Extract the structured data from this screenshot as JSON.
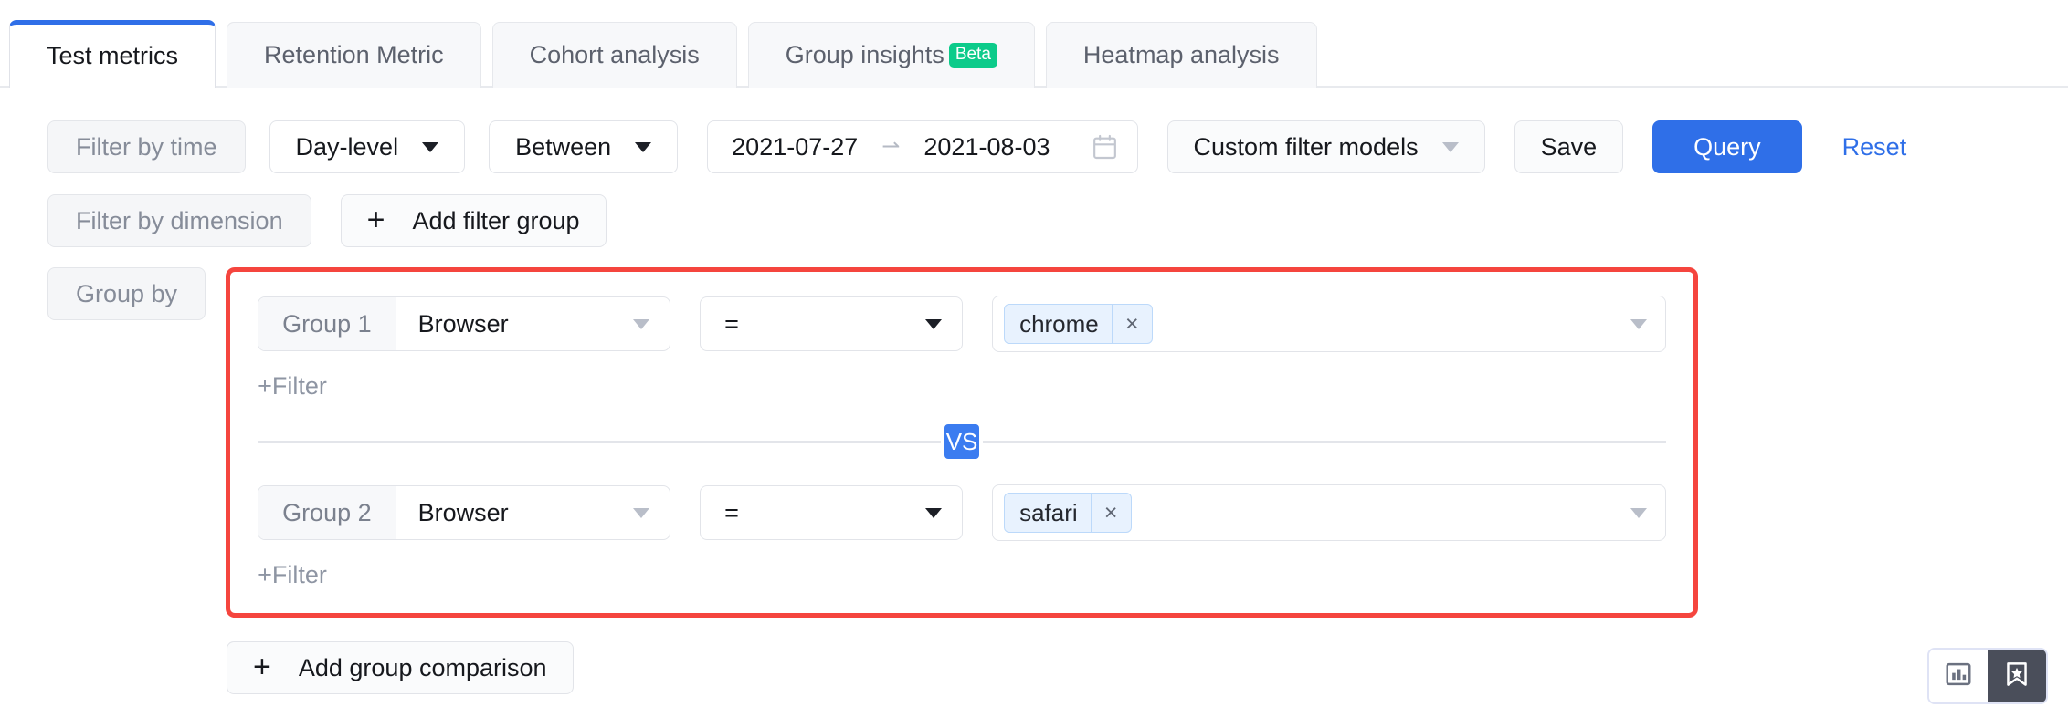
{
  "tabs": [
    {
      "label": "Test metrics",
      "active": true,
      "badge": ""
    },
    {
      "label": "Retention Metric",
      "active": false,
      "badge": ""
    },
    {
      "label": "Cohort analysis",
      "active": false,
      "badge": ""
    },
    {
      "label": "Group insights",
      "active": false,
      "badge": "Beta"
    },
    {
      "label": "Heatmap analysis",
      "active": false,
      "badge": ""
    }
  ],
  "time_filter": {
    "label": "Filter by time",
    "granularity": "Day-level",
    "comparison": "Between",
    "date_start": "2021-07-27",
    "date_end": "2021-08-03",
    "date_arrow": "⇀",
    "calendar_icon": "calendar-icon",
    "custom_models": "Custom filter models",
    "save_label": "Save",
    "query_label": "Query",
    "reset_label": "Reset"
  },
  "dimension_filter": {
    "label": "Filter by dimension",
    "add_filter_group": "Add filter group",
    "plus": "+"
  },
  "group_by": {
    "label": "Group by",
    "add_group_comparison": "Add group comparison",
    "plus": "+",
    "vs_label": "VS",
    "add_filter_link": "+Filter",
    "groups": [
      {
        "name": "Group 1",
        "dimension": "Browser",
        "operator": "=",
        "values": [
          "chrome"
        ],
        "remove_icon": "×",
        "filter_link": "+Filter"
      },
      {
        "name": "Group 2",
        "dimension": "Browser",
        "operator": "=",
        "values": [
          "safari"
        ],
        "remove_icon": "×",
        "filter_link": "+Filter"
      }
    ]
  },
  "view_toggle": {
    "chart_view": "bar-chart-icon",
    "saved_view": "bookmark-star-icon",
    "active": "saved_view"
  },
  "colors": {
    "accent_blue": "#2f6fe8",
    "vs_blue": "#3b7cf0",
    "beta_green": "#0ccb8a",
    "highlight_red": "#f5453e",
    "tag_blue_bg": "#e8f2fe",
    "tag_blue_border": "#bcd9fa",
    "segment_active": "#4a4e5a"
  }
}
